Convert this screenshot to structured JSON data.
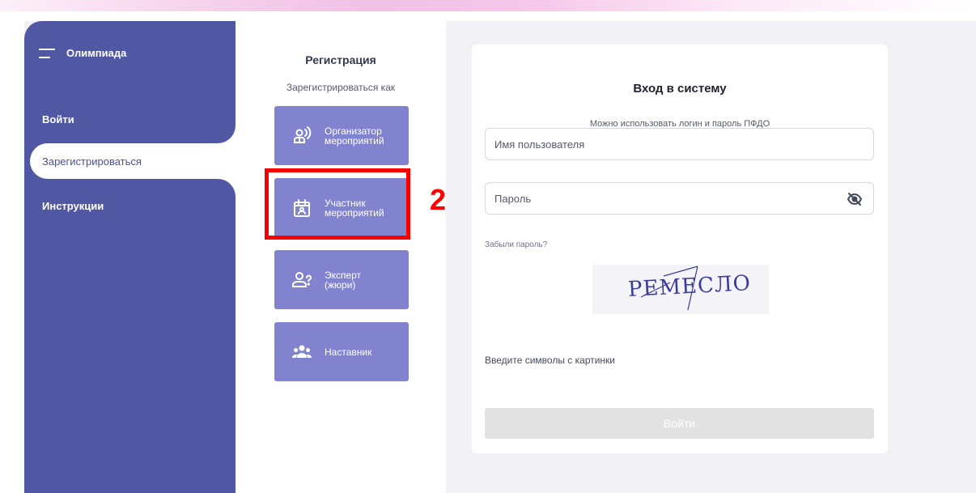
{
  "sidebar": {
    "title": "Олимпиада",
    "menu_icon": "hamburger-icon",
    "items": [
      {
        "label": "Войти",
        "active": false
      },
      {
        "label": "Зарегистрироваться",
        "active": true
      },
      {
        "label": "Инструкции",
        "active": false
      }
    ]
  },
  "registration": {
    "title": "Регистрация",
    "subtitle": "Зарегистрироваться как",
    "roles": [
      {
        "label": "Организатор\nмероприятий",
        "icon": "organizer-icon"
      },
      {
        "label": "Участник\nмероприятий",
        "icon": "calendar-user-icon"
      },
      {
        "label": "Эксперт\n(жюри)",
        "icon": "expert-icon"
      },
      {
        "label": "Наставник",
        "icon": "group-icon"
      }
    ]
  },
  "annotation": {
    "step_number": "2",
    "color": "#f70000"
  },
  "login": {
    "title": "Вход в систему",
    "hint": "Можно использовать логин и пароль ПФДО",
    "username_placeholder": "Имя пользователя",
    "password_placeholder": "Пароль",
    "eye_icon": "eye-off-icon",
    "forgot": "Забыли пароль?",
    "captcha_text": "РЕМЕСЛО",
    "captcha_hint": "Введите символы с картинки",
    "submit": "Войти"
  },
  "colors": {
    "sidebar": "#5158a3",
    "role_card": "#8283cf",
    "background": "#f1f1f6",
    "button_disabled": "#e2e2e2"
  }
}
